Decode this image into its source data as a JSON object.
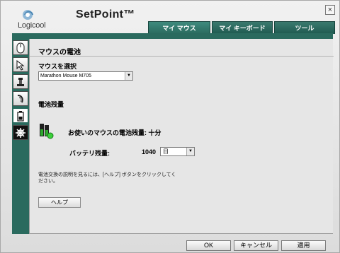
{
  "app": {
    "logo_text": "Logicool",
    "title": "SetPoint™",
    "close_glyph": "×"
  },
  "tabs": [
    {
      "label": "マイ マウス",
      "active": true
    },
    {
      "label": "マイ キーボード",
      "active": false
    },
    {
      "label": "ツール",
      "active": false
    }
  ],
  "sidebar": {
    "icons": [
      "mouse-icon",
      "pointer-icon",
      "game-icon",
      "motion-icon",
      "battery-icon",
      "settings-icon"
    ],
    "active": "battery-icon"
  },
  "panel": {
    "title": "マウスの電池",
    "select_label": "マウスを選択",
    "mouse_select": "Marathon Mouse M705",
    "section_title": "電池残量",
    "remaining_text": "お使いのマウスの電池残量: 十分",
    "battery_life_label": "バッテリ残量:",
    "battery_life_value": "1040",
    "battery_life_unit": "日",
    "help_note": "電池交換の説明を見るには、[ヘルプ] ボタンをクリックしてください。",
    "help_button": "ヘルプ"
  },
  "footer": {
    "ok": "OK",
    "cancel": "キャンセル",
    "apply": "適用"
  },
  "colors": {
    "brand_green": "#2a6a5e",
    "battery_green": "#2faa2f",
    "status_dot": "#3bd03b"
  }
}
